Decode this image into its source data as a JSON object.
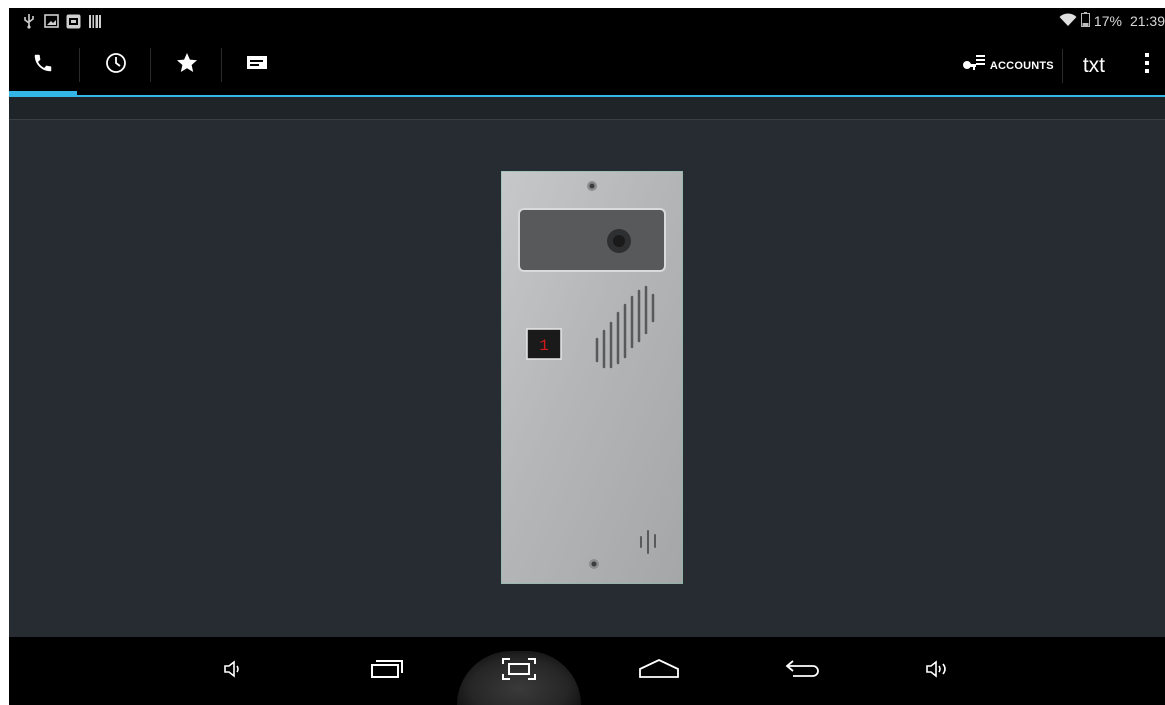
{
  "status_bar": {
    "left_icons": [
      "usb-icon",
      "screenshot-icon",
      "app-notification-icon",
      "barcode-icon"
    ],
    "battery_percent": "17%",
    "time": "21:39"
  },
  "action_bar": {
    "tabs": [
      {
        "name": "tab-dialer",
        "icon": "phone-icon",
        "active": true
      },
      {
        "name": "tab-call-history",
        "icon": "clock-icon",
        "active": false
      },
      {
        "name": "tab-favorites",
        "icon": "star-icon",
        "active": false
      },
      {
        "name": "tab-messages",
        "icon": "message-icon",
        "active": false
      }
    ],
    "accounts_label": "ACCOUNTS",
    "txt_label": "txt",
    "accent_color": "#33b5e5"
  },
  "video": {
    "panel_display_digit": "1"
  },
  "nav_bar": {
    "buttons": [
      "volume-down-icon",
      "recent-apps-icon",
      "screenshot-icon",
      "home-icon",
      "back-icon",
      "volume-up-icon"
    ]
  }
}
